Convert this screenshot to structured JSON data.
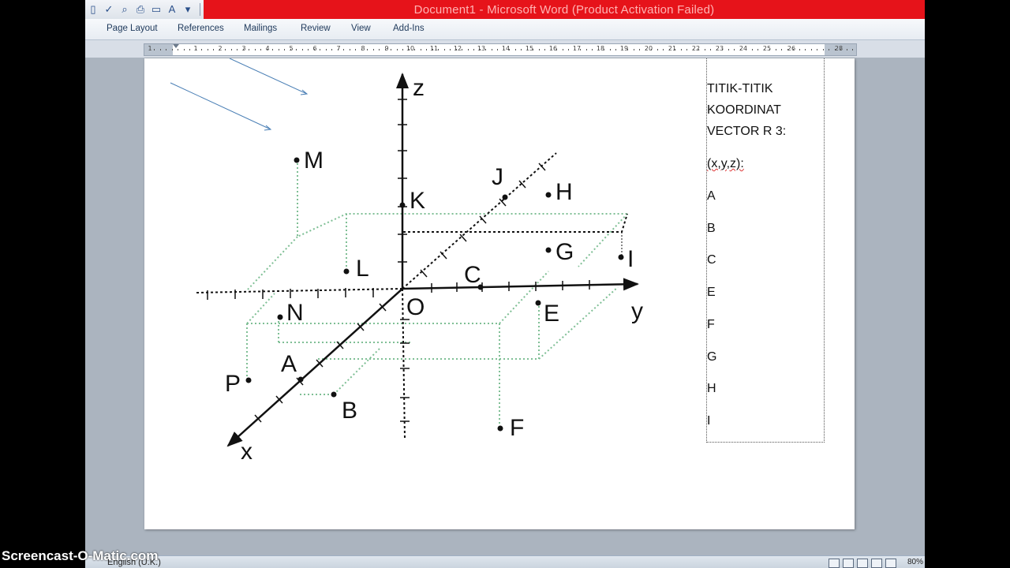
{
  "window": {
    "title": "Document1  -  Microsoft Word (Product Activation Failed)"
  },
  "ribbon": {
    "tabs": [
      "Page Layout",
      "References",
      "Mailings",
      "Review",
      "View",
      "Add-Ins"
    ]
  },
  "ruler": {
    "labels": [
      "1",
      "1",
      "2",
      "3",
      "4",
      "5",
      "6",
      "7",
      "8",
      "9",
      "10",
      "11",
      "12",
      "13",
      "14",
      "15",
      "16",
      "17",
      "18",
      "19",
      "20",
      "21",
      "22",
      "23",
      "24",
      "25",
      "26",
      "28"
    ]
  },
  "diagram": {
    "labels": [
      "z",
      "x",
      "y",
      "O",
      "A",
      "B",
      "C",
      "E",
      "F",
      "G",
      "H",
      "I",
      "J",
      "K",
      "L",
      "M",
      "N",
      "P"
    ]
  },
  "textbox": {
    "title_lines": [
      "TITIK-TITIK",
      "KOORDINAT",
      "VECTOR R 3:"
    ],
    "format": "(x,y,z):",
    "items": [
      "A",
      "B",
      "C",
      "E",
      "F",
      "G",
      "H",
      "I"
    ]
  },
  "statusbar": {
    "language": "English (U.K.)",
    "zoom": "80%"
  },
  "watermark": "Screencast-O-Matic.com",
  "colors": {
    "title_red": "#e6131a",
    "dotted_green": "#7fbf95",
    "arrow_blue": "#4a7fb5"
  }
}
